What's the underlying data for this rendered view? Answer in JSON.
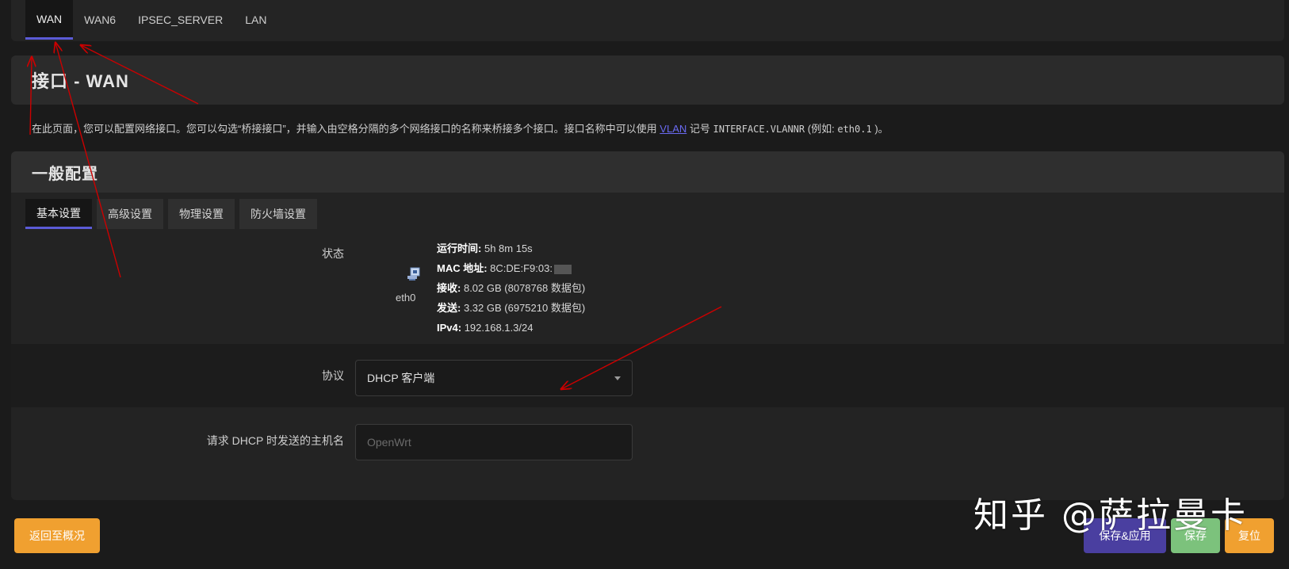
{
  "top_tabs": [
    {
      "label": "WAN",
      "active": true
    },
    {
      "label": "WAN6",
      "active": false
    },
    {
      "label": "IPSEC_SERVER",
      "active": false
    },
    {
      "label": "LAN",
      "active": false
    }
  ],
  "header": {
    "title": "接口 - WAN"
  },
  "description": {
    "text_before": "在此页面，您可以配置网络接口。您可以勾选“桥接接口”，并输入由空格分隔的多个网络接口的名称来桥接多个接口。接口名称中可以使用",
    "link": "VLAN",
    "text_mid": "记号",
    "code1": "INTERFACE.VLANNR",
    "text_example": "(例如:",
    "code2": "eth0.1",
    "text_after": ")。"
  },
  "section": {
    "title": "一般配置",
    "sub_tabs": [
      {
        "label": "基本设置",
        "active": true
      },
      {
        "label": "高级设置",
        "active": false
      },
      {
        "label": "物理设置",
        "active": false
      },
      {
        "label": "防火墙设置",
        "active": false
      }
    ]
  },
  "status": {
    "label": "状态",
    "interface_name": "eth0",
    "interface_icon": "ethernet-port-icon",
    "uptime_label": "运行时间:",
    "uptime_value": "5h 8m 15s",
    "mac_label": "MAC 地址:",
    "mac_value": "8C:DE:F9:03:",
    "rx_label": "接收:",
    "rx_value": "8.02 GB (8078768 数据包)",
    "tx_label": "发送:",
    "tx_value": "3.32 GB (6975210 数据包)",
    "ipv4_label": "IPv4:",
    "ipv4_value": "192.168.1.3/24"
  },
  "protocol": {
    "label": "协议",
    "value": "DHCP 客户端"
  },
  "hostname": {
    "label": "请求 DHCP 时发送的主机名",
    "placeholder": "OpenWrt"
  },
  "buttons": {
    "back": "返回至概况",
    "save_apply": "保存&应用",
    "save": "保存",
    "reset": "复位"
  },
  "watermark": "知乎 @萨拉曼卡",
  "colors": {
    "accent": "#5b5bd6",
    "orange_button": "#f0a030",
    "save_apply_button": "#4a3fa0",
    "save_button": "#7cc27c",
    "annotation_arrow": "#cc0000"
  }
}
